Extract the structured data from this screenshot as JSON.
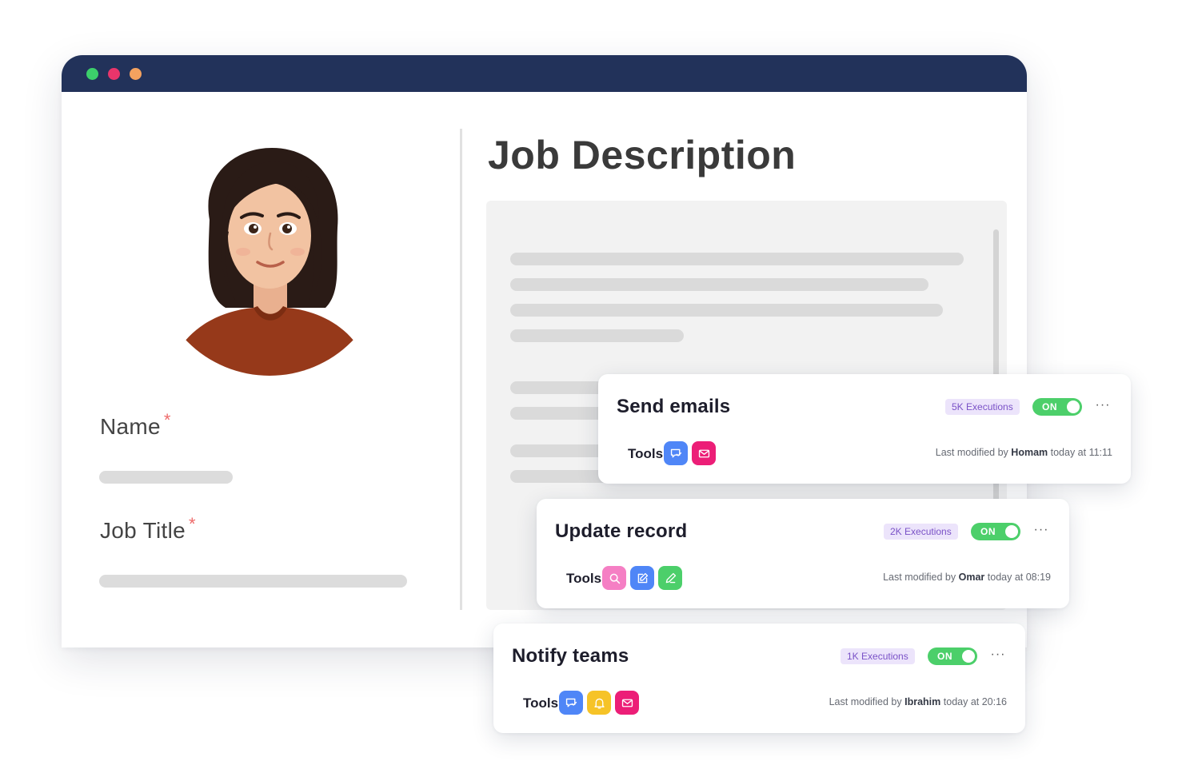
{
  "window": {
    "traffic_lights": [
      "#3ccf6b",
      "#e9356b",
      "#f4a25f"
    ],
    "titlebar_color": "#22325a"
  },
  "profile": {
    "avatar_icon": "woman-avatar",
    "name_label": "Name",
    "job_title_label": "Job Title",
    "required_marker": "*"
  },
  "job_description": {
    "title": "Job Description"
  },
  "workflows": [
    {
      "title": "Send emails",
      "executions": "5K Executions",
      "toggle": "ON",
      "more": "···",
      "tools_label": "Tools",
      "tools": [
        {
          "icon": "chat-icon",
          "color": "#4f86f7"
        },
        {
          "icon": "mail-icon",
          "color": "#ec1e77"
        }
      ],
      "modified_prefix": "Last modified by",
      "modified_by": "Homam",
      "modified_time": "today at 11:11"
    },
    {
      "title": "Update record",
      "executions": "2K Executions",
      "toggle": "ON",
      "more": "···",
      "tools_label": "Tools",
      "tools": [
        {
          "icon": "search-icon",
          "color": "#f57fc4"
        },
        {
          "icon": "edit-icon",
          "color": "#4f86f7"
        },
        {
          "icon": "pen-icon",
          "color": "#4ccf6a"
        }
      ],
      "modified_prefix": "Last modified by",
      "modified_by": "Omar",
      "modified_time": "today at 08:19"
    },
    {
      "title": "Notify teams",
      "executions": "1K Executions",
      "toggle": "ON",
      "more": "···",
      "tools_label": "Tools",
      "tools": [
        {
          "icon": "chat-icon",
          "color": "#4f86f7"
        },
        {
          "icon": "bell-icon",
          "color": "#f6c327"
        },
        {
          "icon": "mail-icon",
          "color": "#ec1e77"
        }
      ],
      "modified_prefix": "Last modified by",
      "modified_by": "Ibrahim",
      "modified_time": "today at 20:16"
    }
  ]
}
